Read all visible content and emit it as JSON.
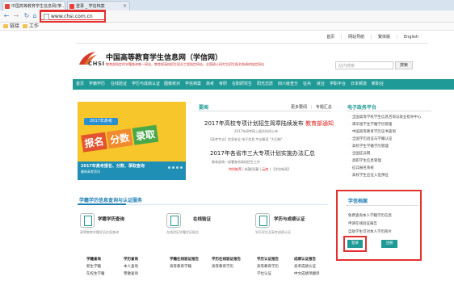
{
  "browser": {
    "tabs": [
      {
        "label": "中国高等教育学生信息网(学…"
      },
      {
        "label": "登录 _ 学信档案"
      }
    ],
    "url": "www.chsi.com.cn",
    "bookmarks": [
      {
        "label": "链接"
      },
      {
        "label": "工作"
      }
    ]
  },
  "toplinks": [
    "首页",
    "网站导航",
    "繁体版",
    "English"
  ],
  "header": {
    "logo": "CHSI",
    "title": "中国高等教育学生信息网（学信网）",
    "subtitle": "教育部指定的学籍查询唯一网站，教育部高校招生阳光工程指定网站，全国硕士研究生招生报名和调剂指定网站",
    "search_placeholder": "站内搜索",
    "search_button": "搜索"
  },
  "nav": [
    "首页",
    "学籍学历",
    "在线验证",
    "学历与成绩认证",
    "图像校对",
    "学信档案",
    "高考",
    "考研",
    "在职研究生",
    "阳光志愿",
    "四六级查分",
    "征兵",
    "就业",
    "学职平台",
    "日本频道",
    "新职业"
  ],
  "banner": {
    "ribbon": "2017年高考",
    "words": [
      "报名",
      "分数",
      "录取"
    ],
    "caption": "2017年高考报名、分数、录取查询",
    "caption2": "最新高考资讯"
  },
  "news": {
    "title": "要闻",
    "more": "更多要闻",
    "special": "专题汇总",
    "items": [
      {
        "headline": "2017年高校专项计划招生简章陆续发布",
        "tag": "教育部通知",
        "sub": "2017年研考网上报名时间公布"
      },
      {
        "headline": "2017年各省市三大专项计划实施办法汇总",
        "sub": "教育部统一部署各地高校招生工作",
        "tags": [
          "特别推荐",
          "新疆/西藏",
          "云南",
          "【学信新闻】"
        ]
      }
    ],
    "sub_links": "【高考专业】信息安全 电子信息 专业解读 \"大归纳\""
  },
  "gov": {
    "title": "电子政务平台",
    "items": [
      "全国高等学校学生信息咨询与就业指导中心",
      "来华留学生学籍学历管理",
      "中国高等教育学历证书查询",
      "全国学历验证与学籍认证",
      "高校学生学籍学历管理",
      "全国征兵网",
      "高职学生信息管理",
      "征兵报名系统",
      "高校学生应征入伍预征"
    ]
  },
  "services": {
    "section_title": "学籍学历信息查询与认证服务",
    "cards": [
      {
        "name": "学籍学历查询",
        "desc": "高等教育学籍学历信息查询",
        "links": [
          [
            "学籍查询",
            "学历查询"
          ],
          [
            "新生学籍",
            "本人查询"
          ],
          [
            "在校生学籍",
            "零散查询"
          ]
        ]
      },
      {
        "name": "在线验证",
        "desc": "在线验证学籍学历报告",
        "links": [
          [
            "学籍在线验证报告",
            "学历在线验证报告"
          ],
          [
            "高等教育学籍",
            "高等教育学历"
          ]
        ]
      },
      {
        "name": "学历与成绩认证",
        "desc": "学历学位及高考成绩认证",
        "links": [
          [
            "学历认证报告",
            "成绩认证报告"
          ],
          [
            "高等教育学历",
            "高考成绩认证"
          ],
          [
            "学位认证",
            "中文成绩单翻译"
          ]
        ]
      }
    ]
  },
  "dangan": {
    "title": "学信档案",
    "items": [
      "免费查询本人学籍学历信息",
      "申请在线验证报告",
      "自助学生可对本人学历照片"
    ],
    "login": "登录",
    "register": "注册"
  }
}
